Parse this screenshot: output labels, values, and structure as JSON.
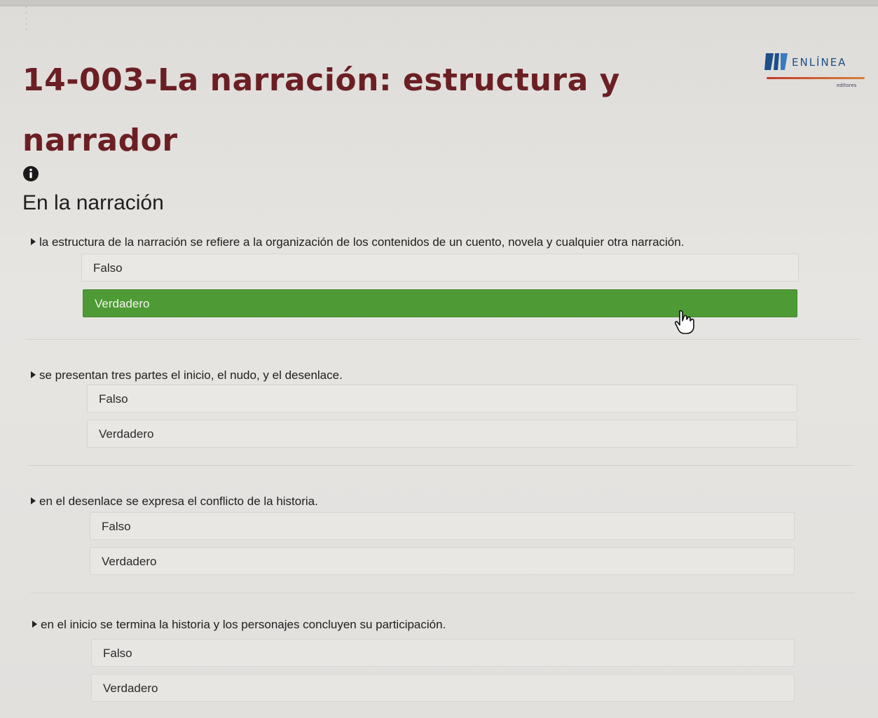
{
  "page": {
    "title": "14-003-La narración: estructura y narrador"
  },
  "logo": {
    "icon": "book-logo-icon",
    "name": "ENLÍNEA",
    "subtitle": "editores"
  },
  "section": {
    "heading": "En la narración",
    "info_icon": "info-circle-icon"
  },
  "questions": [
    {
      "statement": "la estructura de la narración se refiere a la organización de los contenidos de un cuento, novela y cualquier otra narración.",
      "options": [
        "Falso",
        "Verdadero"
      ],
      "selected": "Verdadero"
    },
    {
      "statement": "se presentan tres partes el inicio, el nudo, y el desenlace.",
      "options": [
        "Falso",
        "Verdadero"
      ],
      "selected": null
    },
    {
      "statement": "en el desenlace se expresa el conflicto de la historia.",
      "options": [
        "Falso",
        "Verdadero"
      ],
      "selected": null
    },
    {
      "statement": "en el inicio se termina la historia y los personajes concluyen su participación.",
      "options": [
        "Falso",
        "Verdadero"
      ],
      "selected": null
    }
  ],
  "colors": {
    "title": "#6b1f24",
    "selected_option": "#4e9a35",
    "logo_blue": "#1d4f8a",
    "logo_accent": "#c23a2c"
  },
  "cursor_icon": "hand-pointer-icon"
}
